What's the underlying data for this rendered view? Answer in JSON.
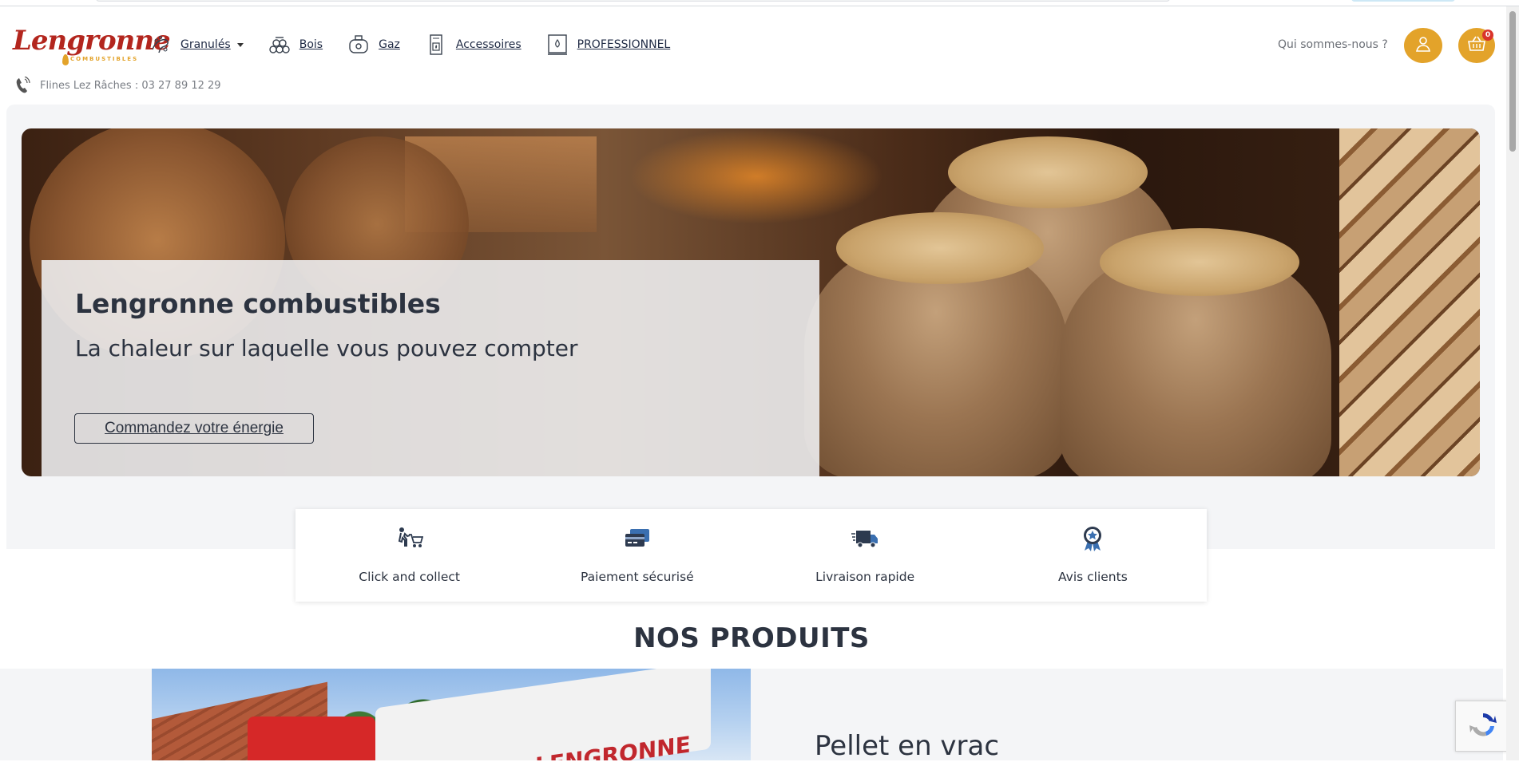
{
  "brand": {
    "logo_text": "Lengronne",
    "logo_sub": "COMBUSTIBLES"
  },
  "nav": [
    {
      "label": "Granulés",
      "icon": "pellets-icon",
      "has_dropdown": true
    },
    {
      "label": "Bois",
      "icon": "wood-logs-icon"
    },
    {
      "label": "Gaz",
      "icon": "gas-bottle-icon"
    },
    {
      "label": "Accessoires",
      "icon": "stove-icon"
    },
    {
      "label": "PROFESSIONNEL",
      "icon": "pallet-sack-icon"
    }
  ],
  "header": {
    "about_label": "Qui sommes-nous ?",
    "cart_count": "0",
    "phone_text": "Flines Lez Râches : 03 27 89 12 29"
  },
  "hero": {
    "title": "Lengronne combustibles",
    "subtitle": "La chaleur sur laquelle vous pouvez compter",
    "cta_label": "Commandez votre énergie"
  },
  "features": [
    {
      "label": "Click and collect",
      "icon": "click-collect-icon"
    },
    {
      "label": "Paiement sécurisé",
      "icon": "credit-card-icon"
    },
    {
      "label": "Livraison rapide",
      "icon": "delivery-truck-icon"
    },
    {
      "label": "Avis clients",
      "icon": "award-badge-icon"
    }
  ],
  "products": {
    "section_title": "NOS PRODUITS",
    "first_title": "Pellet en vrac",
    "truck_text": "LENGRONNE"
  },
  "colors": {
    "accent": "#e3a32a",
    "brand_red": "#b3261e",
    "text": "#2c3340"
  }
}
